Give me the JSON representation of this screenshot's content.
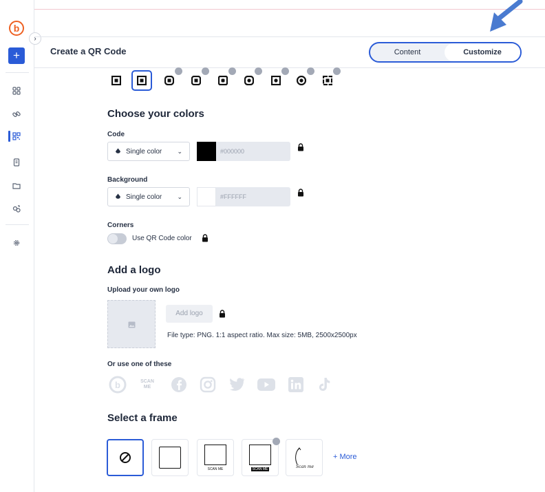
{
  "app": {
    "title": "Create a QR Code",
    "logo_letter": "b"
  },
  "tabs": [
    {
      "label": "Content",
      "active": false
    },
    {
      "label": "Customize",
      "active": true
    }
  ],
  "sidebar": {
    "create_label": "+",
    "items": [
      {
        "icon": "dashboard-icon",
        "active": false
      },
      {
        "icon": "link-icon",
        "active": false
      },
      {
        "icon": "qr-code-icon",
        "active": true
      },
      {
        "icon": "pages-icon",
        "active": false
      },
      {
        "icon": "folder-icon",
        "active": false
      },
      {
        "icon": "campaigns-icon",
        "active": false
      },
      {
        "icon": "settings-icon",
        "active": false
      }
    ]
  },
  "patterns": {
    "count": 9,
    "selected_index": 1,
    "locked_from_index": 2
  },
  "colors": {
    "heading": "Choose your colors",
    "code": {
      "label": "Code",
      "mode": "Single color",
      "hex": "#000000",
      "swatch": "#000000"
    },
    "background": {
      "label": "Background",
      "mode": "Single color",
      "hex": "#FFFFFF",
      "swatch": "#ffffff"
    },
    "corners": {
      "label": "Corners",
      "toggle_label": "Use QR Code color",
      "enabled": false
    }
  },
  "logo": {
    "heading": "Add a logo",
    "upload_label": "Upload your own logo",
    "add_button": "Add logo",
    "file_info": "File type: PNG. 1:1 aspect ratio. Max size: 5MB, 2500x2500px",
    "or_use_label": "Or use one of these",
    "scan_me": "SCAN ME",
    "options": [
      "bitly-icon",
      "scan-me-icon",
      "facebook-icon",
      "instagram-icon",
      "twitter-icon",
      "youtube-icon",
      "linkedin-icon",
      "tiktok-icon"
    ]
  },
  "frame": {
    "heading": "Select a frame",
    "frame_text": "SCAN ME",
    "frame_script": "Scan me",
    "more_label": "+ More"
  },
  "colors_theme": {
    "accent": "#2a5bd7",
    "brand": "#ee6123"
  }
}
